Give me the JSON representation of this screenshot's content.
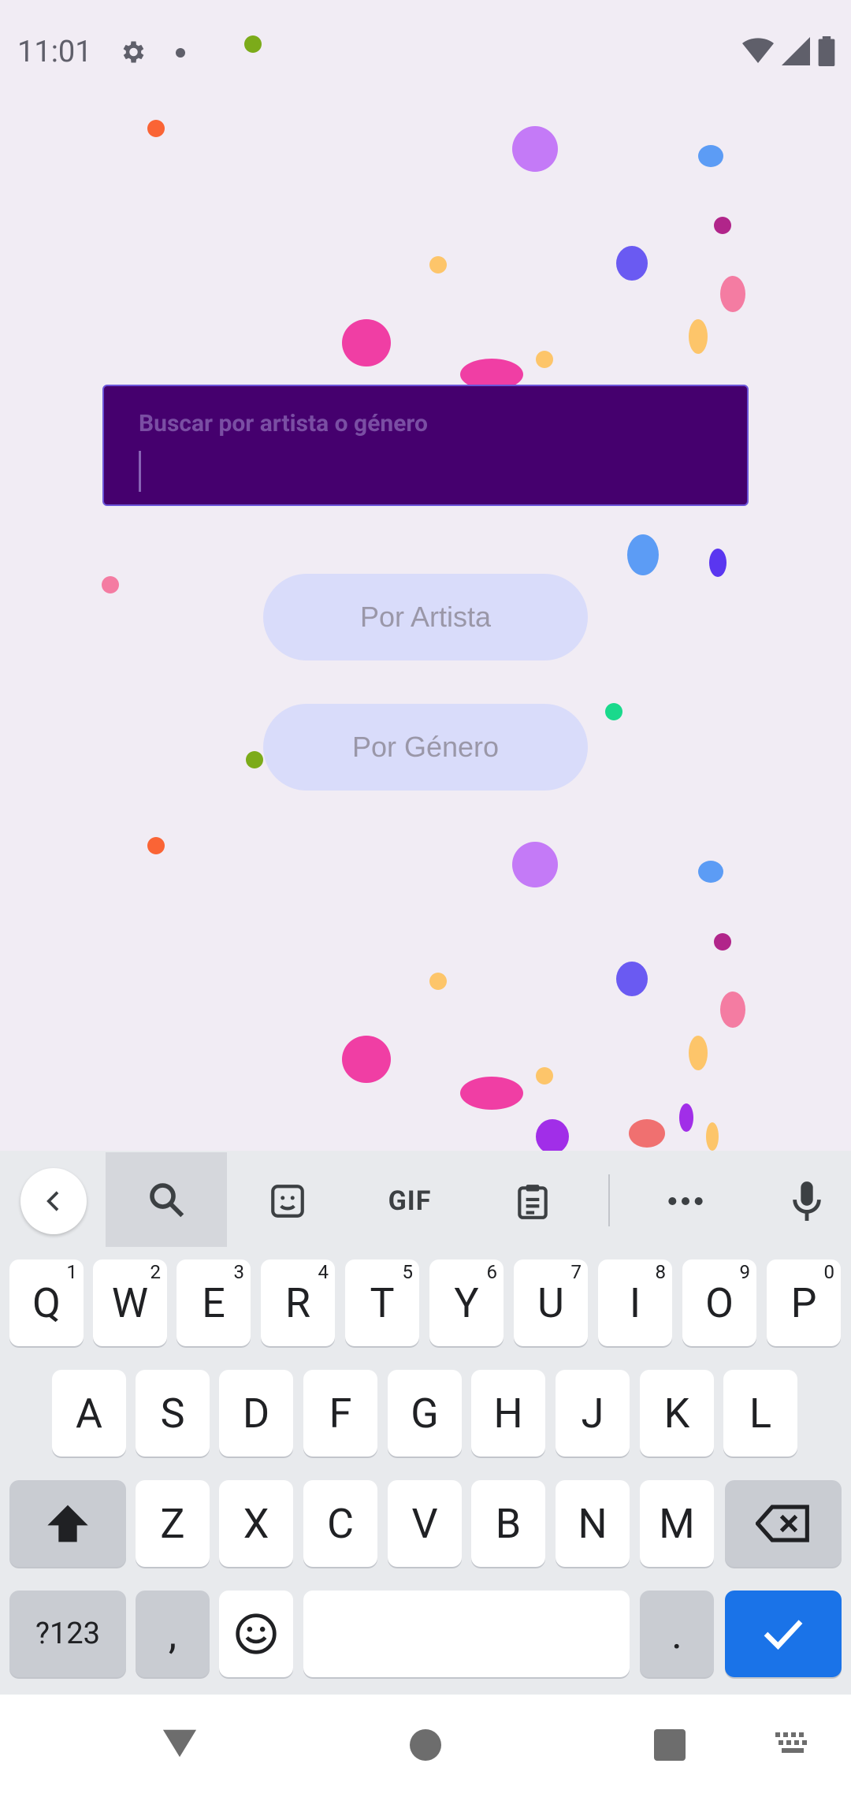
{
  "status_bar": {
    "time": "11:01"
  },
  "search": {
    "placeholder": "Buscar por artista o género",
    "value": ""
  },
  "buttons": {
    "by_artist": "Por Artista",
    "by_genre": "Por Género"
  },
  "keyboard": {
    "toolbar": {
      "gif_label": "GIF"
    },
    "row1": [
      {
        "label": "Q",
        "hint": "1"
      },
      {
        "label": "W",
        "hint": "2"
      },
      {
        "label": "E",
        "hint": "3"
      },
      {
        "label": "R",
        "hint": "4"
      },
      {
        "label": "T",
        "hint": "5"
      },
      {
        "label": "Y",
        "hint": "6"
      },
      {
        "label": "U",
        "hint": "7"
      },
      {
        "label": "I",
        "hint": "8"
      },
      {
        "label": "O",
        "hint": "9"
      },
      {
        "label": "P",
        "hint": "0"
      }
    ],
    "row2": [
      "A",
      "S",
      "D",
      "F",
      "G",
      "H",
      "J",
      "K",
      "L"
    ],
    "row3": [
      "Z",
      "X",
      "C",
      "V",
      "B",
      "N",
      "M"
    ],
    "row4": {
      "symbols": "?123",
      "comma": ",",
      "period": "."
    }
  },
  "colors": {
    "background": "#f1ecf4",
    "search_bg": "#45006e",
    "button_bg": "#d9dcfa",
    "enter_key": "#1a73e8"
  }
}
